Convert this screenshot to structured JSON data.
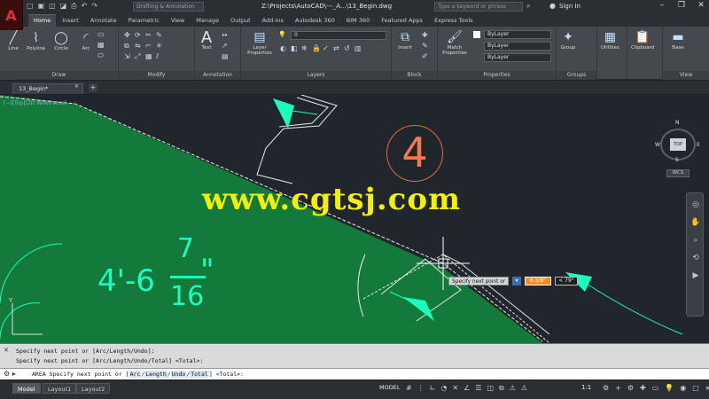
{
  "titlebar": {
    "app_logo": "A",
    "workspace": "Drafting & Annotation",
    "doc_title": "Z:\\Projects\\AutoCAD\\---_A...\\13_Begin.dwg",
    "search_placeholder": "Type a keyword or phrase",
    "signin": "Sign In"
  },
  "ribbon_tabs": [
    "Home",
    "Insert",
    "Annotate",
    "Parametric",
    "View",
    "Manage",
    "Output",
    "Add-ins",
    "Autodesk 360",
    "BIM 360",
    "Featured Apps",
    "Express Tools"
  ],
  "ribbon": {
    "draw": {
      "title": "Draw",
      "line": "Line",
      "polyline": "Polyline",
      "circle": "Circle",
      "arc": "Arc"
    },
    "modify": {
      "title": "Modify"
    },
    "annotation": {
      "title": "Annotation",
      "text": "Text"
    },
    "layers": {
      "title": "Layers",
      "layer_properties": "Layer Properties",
      "layer_combo": "0"
    },
    "block": {
      "title": "Block",
      "insert": "Insert"
    },
    "properties": {
      "title": "Properties",
      "match": "Match Properties",
      "bylayer1": "ByLayer",
      "bylayer2": "ByLayer",
      "bylayer3": "ByLayer"
    },
    "groups": {
      "title": "Groups",
      "group": "Group"
    },
    "utilities": {
      "label": "Utilities"
    },
    "clipboard": {
      "label": "Clipboard"
    },
    "view": {
      "title": "View",
      "base": "Base"
    }
  },
  "file_tabs": {
    "active": "13_Begin*"
  },
  "viewport": {
    "controls": "[−][Top][2D Wireframe]",
    "watermark": "www.cgtsj.com",
    "circle_number": "4",
    "dim_whole": "4'-6",
    "dim_num": "7",
    "dim_den": "16",
    "dim_inch": "\"",
    "viewcube": {
      "n": "N",
      "s": "S",
      "e": "E",
      "w": "W",
      "top": "TOP",
      "wcs": "WCS"
    },
    "dyn_prompt": "Specify next point or",
    "dyn_value": "6.3/8\"",
    "dyn_angle": "< 79°",
    "ucs_y": "Y"
  },
  "command": {
    "history": [
      "Specify next point or [Arc/Length/Undo]:",
      "Specify next point or [Arc/Length/Undo/Total] <Total>:"
    ],
    "prompt_prefix": "AREA Specify next point or [",
    "opt_arc": "Arc",
    "opt_length": "Length",
    "opt_undo": "Undo",
    "opt_total": "Total",
    "prompt_suffix": "] <Total>:"
  },
  "status": {
    "tabs": [
      "Model",
      "Layout1",
      "Layout2"
    ],
    "model_space": "MODEL",
    "scale": "1:1"
  },
  "colors": {
    "drawing_green": "#137a3c",
    "dim_cyan": "#19ffc0",
    "watermark_yellow": "#f4f000",
    "circle_orange": "#e4693e"
  }
}
